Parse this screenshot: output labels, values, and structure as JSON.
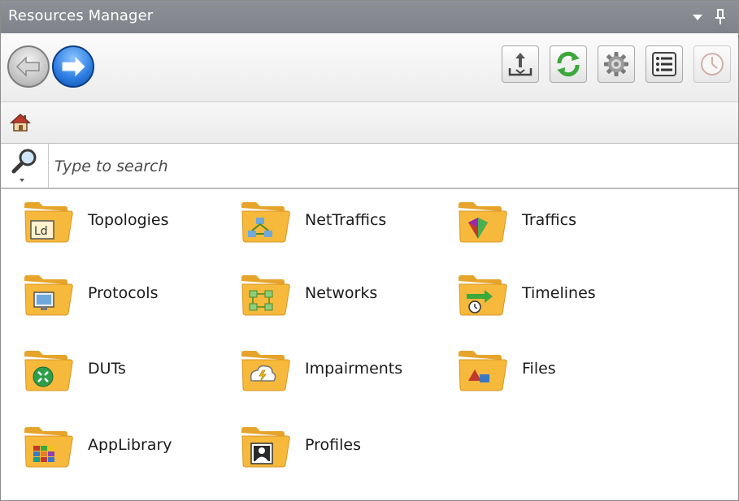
{
  "window": {
    "title": "Resources Manager"
  },
  "toolbar": {
    "buttons": [
      {
        "name": "export",
        "icon": "export-icon"
      },
      {
        "name": "refresh",
        "icon": "refresh-icon"
      },
      {
        "name": "settings",
        "icon": "gear-icon"
      },
      {
        "name": "list-view",
        "icon": "list-icon"
      },
      {
        "name": "history",
        "icon": "clock-icon"
      }
    ]
  },
  "search": {
    "placeholder": "Type to search"
  },
  "folders": [
    {
      "label": "Topologies",
      "icon": "topologies-folder-icon"
    },
    {
      "label": "NetTraffics",
      "icon": "nettraffics-folder-icon"
    },
    {
      "label": "Traffics",
      "icon": "traffics-folder-icon"
    },
    {
      "label": "Protocols",
      "icon": "protocols-folder-icon"
    },
    {
      "label": "Networks",
      "icon": "networks-folder-icon"
    },
    {
      "label": "Timelines",
      "icon": "timelines-folder-icon"
    },
    {
      "label": "DUTs",
      "icon": "duts-folder-icon"
    },
    {
      "label": "Impairments",
      "icon": "impairments-folder-icon"
    },
    {
      "label": "Files",
      "icon": "files-folder-icon"
    },
    {
      "label": "AppLibrary",
      "icon": "applibrary-folder-icon"
    },
    {
      "label": "Profiles",
      "icon": "profiles-folder-icon"
    }
  ],
  "colors": {
    "titlebar": "#878b91",
    "folder": "#f6b93b",
    "accent_blue": "#2a7ce0"
  }
}
